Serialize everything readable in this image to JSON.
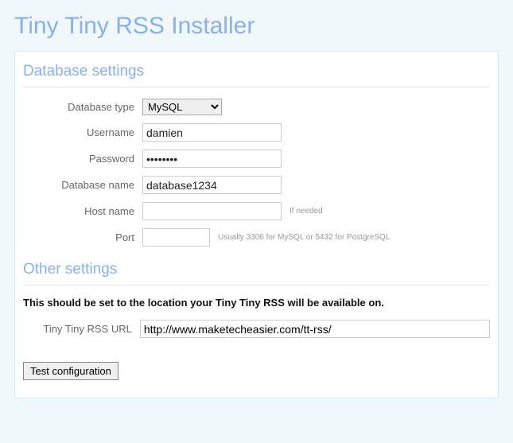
{
  "title": "Tiny Tiny RSS Installer",
  "sections": {
    "database": {
      "heading": "Database settings",
      "labels": {
        "type": "Database type",
        "username": "Username",
        "password": "Password",
        "dbname": "Database name",
        "host": "Host name",
        "port": "Port"
      },
      "values": {
        "type": "MySQL",
        "username": "damien",
        "password": "••••••••",
        "dbname": "database1234",
        "host": "",
        "port": ""
      },
      "hints": {
        "host": "If needed",
        "port": "Usually 3306 for MySQL or 5432 for PostgreSQL"
      }
    },
    "other": {
      "heading": "Other settings",
      "note": "This should be set to the location your Tiny Tiny RSS will be available on.",
      "labels": {
        "url": "Tiny Tiny RSS URL"
      },
      "values": {
        "url": "http://www.maketecheasier.com/tt-rss/"
      }
    }
  },
  "buttons": {
    "test": "Test configuration"
  }
}
